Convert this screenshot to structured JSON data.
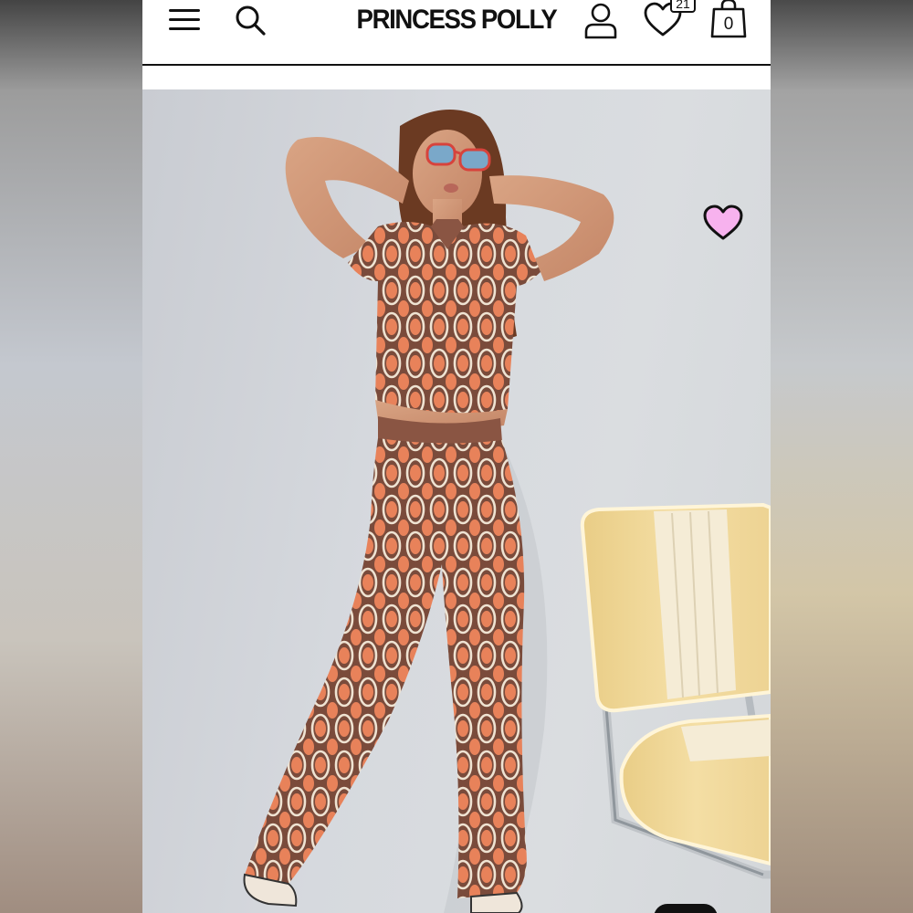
{
  "header": {
    "brand": "PRINCESS POLLY",
    "wishlist_count": "21",
    "bag_count": "0",
    "icons": {
      "menu": "hamburger-menu-icon",
      "search": "search-icon",
      "account": "user-account-icon",
      "wishlist": "heart-icon",
      "bag": "shopping-bag-icon"
    }
  },
  "product_image": {
    "favorite_icon": "heart-icon",
    "favorite_color": "#f7b2ee"
  },
  "colors": {
    "pattern_brown": "#7a4b3b",
    "pattern_orange": "#e8825a",
    "chair_yellow": "#f0d79a"
  }
}
